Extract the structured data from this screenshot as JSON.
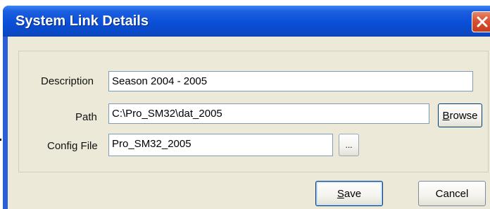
{
  "window": {
    "title": "System Link Details",
    "close_icon": "close-icon"
  },
  "form": {
    "description_label": "Description",
    "description_value": "Season 2004 - 2005",
    "path_label": "Path",
    "path_value": "C:\\Pro_SM32\\dat_2005",
    "config_label": "Config File",
    "config_value": "Pro_SM32_2005"
  },
  "buttons": {
    "browse_prefix": "B",
    "browse_rest": "rowse",
    "ellipsis": "...",
    "save_prefix": "S",
    "save_rest": "ave",
    "cancel": "Cancel"
  },
  "colors": {
    "titlebar": "#0a4fd8",
    "close": "#d9532f",
    "client": "#ece9d8",
    "field_border": "#7f9db9"
  }
}
